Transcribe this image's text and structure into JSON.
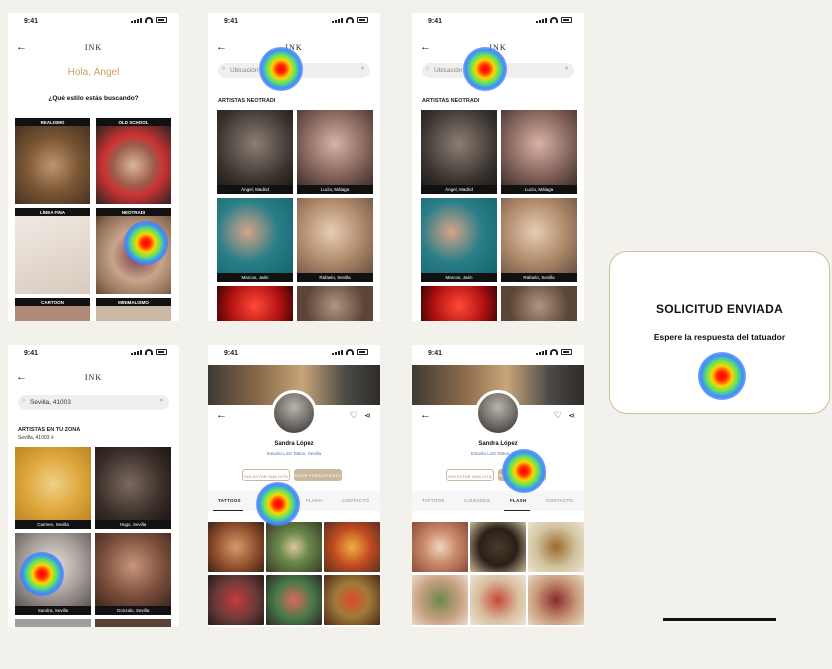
{
  "status": {
    "time": "9:41"
  },
  "brand": "INK",
  "screen1": {
    "greeting": "Hola, Ángel",
    "question": "¿Qué estilo estás buscando?",
    "styles": [
      "REALISMO",
      "OLD SCHOOL",
      "LÍNEA FINA",
      "NEOTRADI",
      "CARTOON",
      "MINIMALISMO"
    ]
  },
  "screen2": {
    "search_placeholder": "Ubicación",
    "section": "ARTISTAS NEOTRADI",
    "artists": [
      "Ángel, Madrid",
      "Lucía, Málaga",
      "Marcos, Jaén",
      "Rafaelo, Sevilla"
    ]
  },
  "screen3": {
    "search_placeholder": "Ubicación",
    "section": "ARTISTAS NEOTRADI",
    "artists": [
      "Ángel, Madrid",
      "Lucía, Málaga",
      "Marcos, Jaén",
      "Rafaelo, Sevilla"
    ]
  },
  "screen4": {
    "search_value": "Sevilla, 41003",
    "section": "ARTISTAS EN TU ZONA",
    "location": "Sevilla, 41003",
    "artists": [
      "Carmen, Sevilla",
      "Hugo, Sevilla",
      "Sandra, Sevilla",
      "Gonzalo, Sevilla"
    ]
  },
  "profile": {
    "name": "Sandra López",
    "link": "Estudio Lost Tattoo, Sevilla",
    "btn_request": "SOLICITAR UNA CITA",
    "btn_flash": "PEDIR PRESUPUESTO",
    "tabs": [
      "TATTOOS",
      "CUIDADOS",
      "FLASH",
      "CONTACTO"
    ]
  },
  "popup": {
    "title": "SOLICITUD ENVIADA",
    "message": "Espere la respuesta del tatuador"
  },
  "colors": {
    "accent": "#cbb79c",
    "gold": "#c9a25a",
    "link": "#4a73b8"
  }
}
